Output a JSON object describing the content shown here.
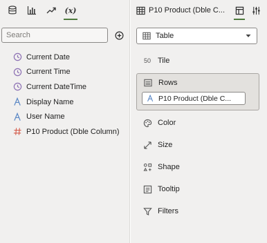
{
  "left": {
    "tabs": [
      {
        "icon": "database-icon"
      },
      {
        "icon": "bar-chart-icon"
      },
      {
        "icon": "trend-icon"
      },
      {
        "icon": "calculation-icon",
        "label": "(x)",
        "active": true
      }
    ],
    "search": {
      "placeholder": "Search"
    },
    "fields": [
      {
        "label": "Current Date",
        "icon": "clock-icon"
      },
      {
        "label": "Current Time",
        "icon": "clock-icon"
      },
      {
        "label": "Current DateTime",
        "icon": "clock-icon"
      },
      {
        "label": "Display Name",
        "icon": "text-attribute-icon"
      },
      {
        "label": "User Name",
        "icon": "text-attribute-icon"
      },
      {
        "label": "P10 Product (Dble Column)",
        "icon": "hash-icon"
      }
    ]
  },
  "right": {
    "header": {
      "title": "P10 Product (Dble C..."
    },
    "viz_type": {
      "label": "Table"
    },
    "grammar": {
      "tile": "Tile",
      "tile_icon_text": "50",
      "rows": "Rows",
      "rows_pill": "P10 Product (Dble C...",
      "color": "Color",
      "size": "Size",
      "shape": "Shape",
      "tooltip": "Tooltip",
      "filters": "Filters"
    }
  },
  "colors": {
    "accent": "#4e7a3d",
    "clock": "#8c6fb3",
    "attribute": "#5a87c5",
    "hash": "#d45b4a"
  }
}
